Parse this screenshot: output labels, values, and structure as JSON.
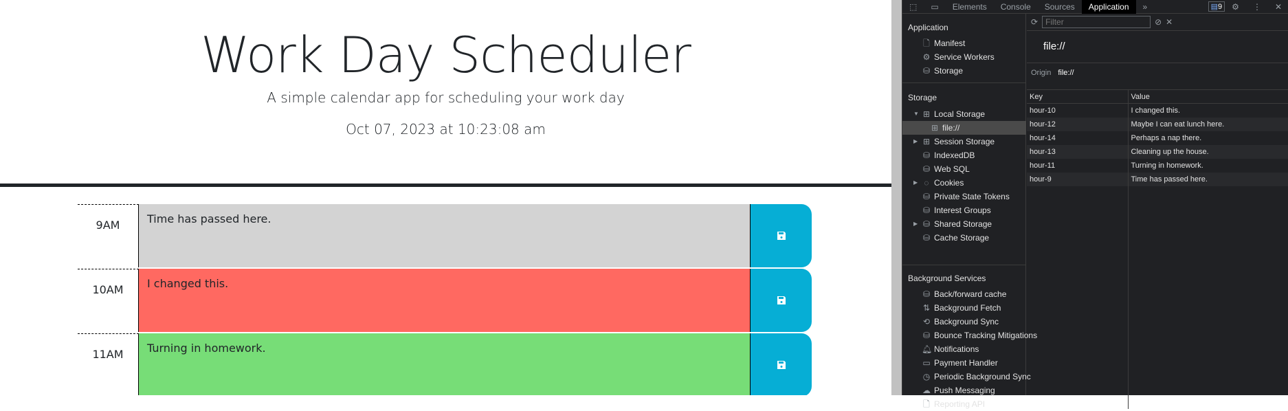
{
  "app": {
    "title": "Work Day Scheduler",
    "subtitle": "A simple calendar app for scheduling your work day",
    "date": "Oct 07, 2023 at 10:23:08 am",
    "colors": {
      "past": "#d3d3d3",
      "present": "#ff6961",
      "future": "#77dd77",
      "save": "#06aed5"
    },
    "rows": [
      {
        "hour": "9AM",
        "text": "Time has passed here.",
        "state": "past"
      },
      {
        "hour": "10AM",
        "text": "I changed this.",
        "state": "present"
      },
      {
        "hour": "11AM",
        "text": "Turning in homework.",
        "state": "future"
      }
    ]
  },
  "devtools": {
    "tabs": [
      "Elements",
      "Console",
      "Sources",
      "Application"
    ],
    "active_tab": "Application",
    "issues_count": "9",
    "sidebar": {
      "app_heading": "Application",
      "app_items": [
        "Manifest",
        "Service Workers",
        "Storage"
      ],
      "storage_heading": "Storage",
      "storage_items": [
        "Local Storage",
        "file://",
        "Session Storage",
        "IndexedDB",
        "Web SQL",
        "Cookies",
        "Private State Tokens",
        "Interest Groups",
        "Shared Storage",
        "Cache Storage"
      ],
      "bg_heading": "Background Services",
      "bg_items": [
        "Back/forward cache",
        "Background Fetch",
        "Background Sync",
        "Bounce Tracking Mitigations",
        "Notifications",
        "Payment Handler",
        "Periodic Background Sync",
        "Push Messaging",
        "Reporting API"
      ]
    },
    "filter_placeholder": "Filter",
    "origin_header": "file://",
    "origin_label": "Origin",
    "origin_value": "file://",
    "table": {
      "headers": [
        "Key",
        "Value"
      ],
      "rows": [
        [
          "hour-10",
          "I changed this."
        ],
        [
          "hour-12",
          "Maybe I can eat lunch here."
        ],
        [
          "hour-14",
          "Perhaps a nap there."
        ],
        [
          "hour-13",
          "Cleaning up the house."
        ],
        [
          "hour-11",
          "Turning in homework."
        ],
        [
          "hour-9",
          "Time has passed here."
        ]
      ]
    }
  }
}
